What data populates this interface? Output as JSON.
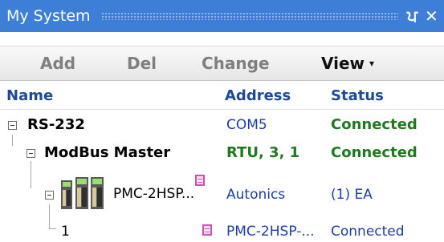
{
  "window": {
    "title": "My System",
    "pin_glyph": "क़",
    "close_glyph": "✕"
  },
  "toolbar": {
    "add_label": "Add",
    "del_label": "Del",
    "change_label": "Change",
    "view_label": "View",
    "view_caret": "▾"
  },
  "columns": {
    "name": "Name",
    "address": "Address",
    "status": "Status"
  },
  "tree": {
    "rs232": {
      "name": "RS-232",
      "address": "COM5",
      "status": "Connected"
    },
    "modbus": {
      "name": "ModBus Master",
      "address": "RTU, 3, 1",
      "status": "Connected"
    },
    "device": {
      "name": "PMC-2HSP...",
      "address": "Autonics",
      "status": "(1) EA"
    },
    "unit": {
      "name": "1",
      "address": "PMC-2HSP-...",
      "status": "Connected"
    }
  },
  "colors": {
    "titlebar": "#3d7fd6",
    "header_text": "#1c4a96",
    "connected": "#1f7a1f",
    "rtu_text": "#1f7a1f"
  }
}
